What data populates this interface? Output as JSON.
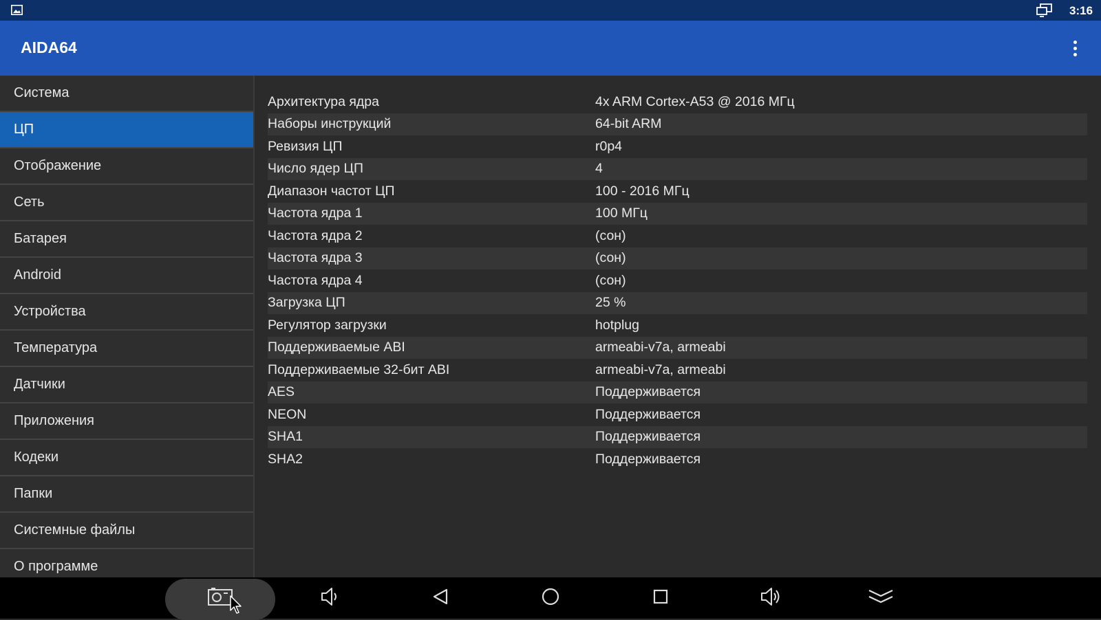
{
  "status_bar": {
    "left_icon": "image-notification-icon",
    "right_icon": "cast-screen-icon",
    "time": "3:16"
  },
  "app_bar": {
    "title": "AIDA64",
    "menu_icon": "more-vert-icon"
  },
  "sidebar": {
    "items": [
      {
        "label": "Система",
        "active": false
      },
      {
        "label": "ЦП",
        "active": true
      },
      {
        "label": "Отображение",
        "active": false
      },
      {
        "label": "Сеть",
        "active": false
      },
      {
        "label": "Батарея",
        "active": false
      },
      {
        "label": "Android",
        "active": false
      },
      {
        "label": "Устройства",
        "active": false
      },
      {
        "label": "Температура",
        "active": false
      },
      {
        "label": "Датчики",
        "active": false
      },
      {
        "label": "Приложения",
        "active": false
      },
      {
        "label": "Кодеки",
        "active": false
      },
      {
        "label": "Папки",
        "active": false
      },
      {
        "label": "Системные файлы",
        "active": false
      },
      {
        "label": "О программе",
        "active": false
      }
    ]
  },
  "cpu_info": {
    "rows": [
      {
        "label": "Архитектура ядра",
        "value": "4x ARM Cortex-A53 @ 2016 МГц"
      },
      {
        "label": "Наборы инструкций",
        "value": "64-bit ARM"
      },
      {
        "label": "Ревизия ЦП",
        "value": "r0p4"
      },
      {
        "label": "Число ядер ЦП",
        "value": "4"
      },
      {
        "label": "Диапазон частот ЦП",
        "value": "100 - 2016 МГц"
      },
      {
        "label": "Частота ядра 1",
        "value": "100 МГц"
      },
      {
        "label": "Частота ядра 2",
        "value": "(сон)"
      },
      {
        "label": "Частота ядра 3",
        "value": "(сон)"
      },
      {
        "label": "Частота ядра 4",
        "value": "(сон)"
      },
      {
        "label": "Загрузка ЦП",
        "value": "25 %"
      },
      {
        "label": "Регулятор загрузки",
        "value": "hotplug"
      },
      {
        "label": "Поддерживаемые ABI",
        "value": "armeabi-v7a, armeabi"
      },
      {
        "label": "Поддерживаемые 32-бит ABI",
        "value": "armeabi-v7a, armeabi"
      },
      {
        "label": "AES",
        "value": "Поддерживается"
      },
      {
        "label": "NEON",
        "value": "Поддерживается"
      },
      {
        "label": "SHA1",
        "value": "Поддерживается"
      },
      {
        "label": "SHA2",
        "value": "Поддерживается"
      }
    ]
  },
  "nav_bar": {
    "buttons": [
      {
        "name": "screenshot-button",
        "icon": "camera-icon"
      },
      {
        "name": "volume-down-button",
        "icon": "volume-down-icon"
      },
      {
        "name": "back-button",
        "icon": "back-triangle-icon"
      },
      {
        "name": "home-button",
        "icon": "home-circle-icon"
      },
      {
        "name": "recents-button",
        "icon": "recents-square-icon"
      },
      {
        "name": "volume-up-button",
        "icon": "volume-up-icon"
      },
      {
        "name": "collapse-button",
        "icon": "double-chevron-down-icon"
      }
    ]
  },
  "colors": {
    "status_bar": "#0d3068",
    "app_bar": "#1f56b8",
    "active_item": "#1662b4",
    "background": "#2b2b2b"
  }
}
